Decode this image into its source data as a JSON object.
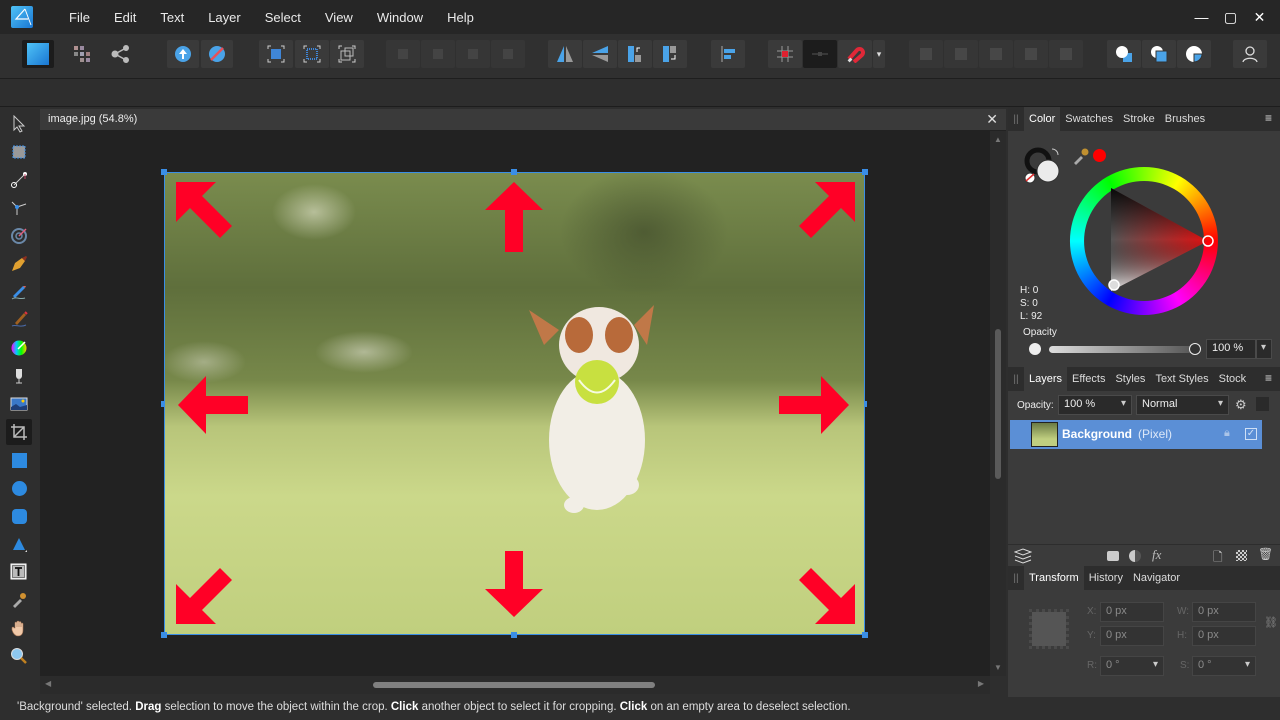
{
  "app": {
    "name": "Affinity Photo",
    "logo_icon": "affinity-photo-logo"
  },
  "menubar": {
    "items": [
      "File",
      "Edit",
      "Text",
      "Layer",
      "Select",
      "View",
      "Window",
      "Help"
    ],
    "window_controls": {
      "minimize": "—",
      "maximize": "▢",
      "close": "✕"
    }
  },
  "toolbar": {
    "groups": [
      [
        "photo-persona",
        "liquify-persona",
        "export-persona"
      ],
      [
        "develop-persona-upload",
        "tone-mapping-persona"
      ],
      [
        "quick-mask",
        "refine-selection",
        "transform-selection"
      ],
      [
        "arrange-back",
        "arrange-backward",
        "arrange-forward",
        "arrange-front"
      ],
      [
        "flip-horizontal",
        "flip-vertical",
        "rotate-left",
        "rotate-right"
      ],
      [
        "align"
      ],
      [
        "snapping-grid",
        "snapping-toggle",
        "snapping-magnet",
        "snapping-dropdown"
      ],
      [
        "boolean-add",
        "boolean-subtract",
        "boolean-intersect",
        "boolean-xor",
        "boolean-divide"
      ],
      [
        "insert-behind",
        "insert-top",
        "insert-inside"
      ],
      [
        "account"
      ]
    ]
  },
  "tools": [
    "move",
    "artboard",
    "view-crop",
    "node",
    "selection-brush",
    "pen",
    "pencil",
    "paint-brush",
    "color-picker-wheel",
    "flood-fill",
    "place-image",
    "crop",
    "rectangle",
    "ellipse",
    "rounded-rectangle",
    "triangle",
    "text",
    "color-picker",
    "hand",
    "zoom"
  ],
  "active_tool": "crop",
  "document": {
    "tab_title": "image.jpg (54.8%)",
    "close_label": "✕",
    "zoom_percent": 54.8,
    "vscroll_position": 0.5,
    "hscroll_position": 0.5
  },
  "color_panel": {
    "tabs": [
      "Color",
      "Swatches",
      "Stroke",
      "Brushes"
    ],
    "active_tab": "Color",
    "hsl": {
      "h": "H: 0",
      "s": "S: 0",
      "l": "L: 92"
    },
    "opacity_label": "Opacity",
    "opacity_value": "100 %",
    "fill_color": "#ebebeb",
    "picked_color": "#ff0000"
  },
  "layers_panel": {
    "tabs": [
      "Layers",
      "Effects",
      "Styles",
      "Text Styles",
      "Stock"
    ],
    "active_tab": "Layers",
    "opacity_label": "Opacity:",
    "opacity_value": "100 %",
    "blend_mode": "Normal",
    "layers": [
      {
        "name": "Background",
        "type": "(Pixel)",
        "selected": true,
        "visible": true
      }
    ]
  },
  "transform_panel": {
    "tabs": [
      "Transform",
      "History",
      "Navigator"
    ],
    "active_tab": "Transform",
    "fields": {
      "x": {
        "label": "X:",
        "value": "0 px"
      },
      "y": {
        "label": "Y:",
        "value": "0 px"
      },
      "w": {
        "label": "W:",
        "value": "0 px"
      },
      "h": {
        "label": "H:",
        "value": "0 px"
      },
      "r": {
        "label": "R:",
        "value": "0 °"
      },
      "s": {
        "label": "S:",
        "value": "0 °"
      }
    }
  },
  "status": {
    "parts": [
      {
        "text": "'Background' selected. ",
        "bold": false
      },
      {
        "text": "Drag",
        "bold": true
      },
      {
        "text": " selection to move the object within the crop. ",
        "bold": false
      },
      {
        "text": "Click",
        "bold": true
      },
      {
        "text": " another object to select it for cropping. ",
        "bold": false
      },
      {
        "text": "Click",
        "bold": true
      },
      {
        "text": " on an empty area to deselect selection.",
        "bold": false
      }
    ]
  },
  "colors": {
    "accent": "#3a8ee6",
    "selection_row": "#5b8fd6",
    "arrow": "#ff0026"
  }
}
